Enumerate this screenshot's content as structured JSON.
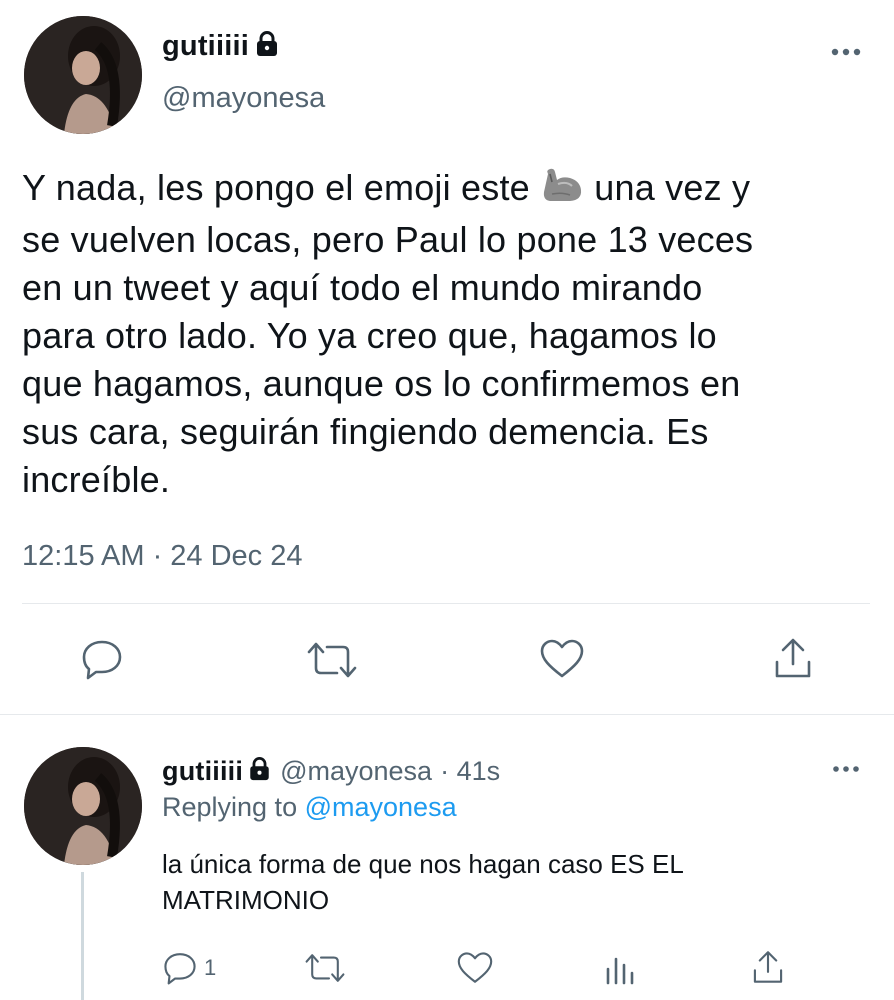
{
  "main_tweet": {
    "author": {
      "name": "gutiiiii",
      "handle": "@mayonesa",
      "protected": true
    },
    "text_line1_before": "Y nada, les pongo el emoji este",
    "text_line1_after": "una vez y",
    "text_rest": [
      "se vuelven locas, pero Paul lo pone 13 veces",
      "en un tweet y aquí todo el mundo mirando",
      "para otro lado. Yo ya creo que, hagamos lo",
      "que hagamos, aunque os lo confirmemos en",
      "sus cara, seguirán fingiendo demencia. Es",
      "increíble."
    ],
    "emoji": "flexed-biceps",
    "timestamp": "12:15 AM · 24 Dec 24",
    "actions": [
      "reply-icon",
      "retweet-icon",
      "like-icon",
      "share-icon"
    ]
  },
  "reply_tweet": {
    "author": {
      "name": "gutiiiii",
      "handle": "@mayonesa",
      "protected": true
    },
    "time": "· 41s",
    "replying_prefix": "Replying to",
    "replying_to": "@mayonesa",
    "text_lines": [
      "la única forma de que nos hagan caso ES EL",
      "MATRIMONIO"
    ],
    "reply_count": "1",
    "actions": [
      "reply-icon",
      "retweet-icon",
      "like-icon",
      "analytics-icon",
      "share-icon"
    ]
  },
  "colors": {
    "text": "#0f1419",
    "secondary": "#536471",
    "link": "#1d9bf0",
    "divider": "#e6e9ec"
  }
}
